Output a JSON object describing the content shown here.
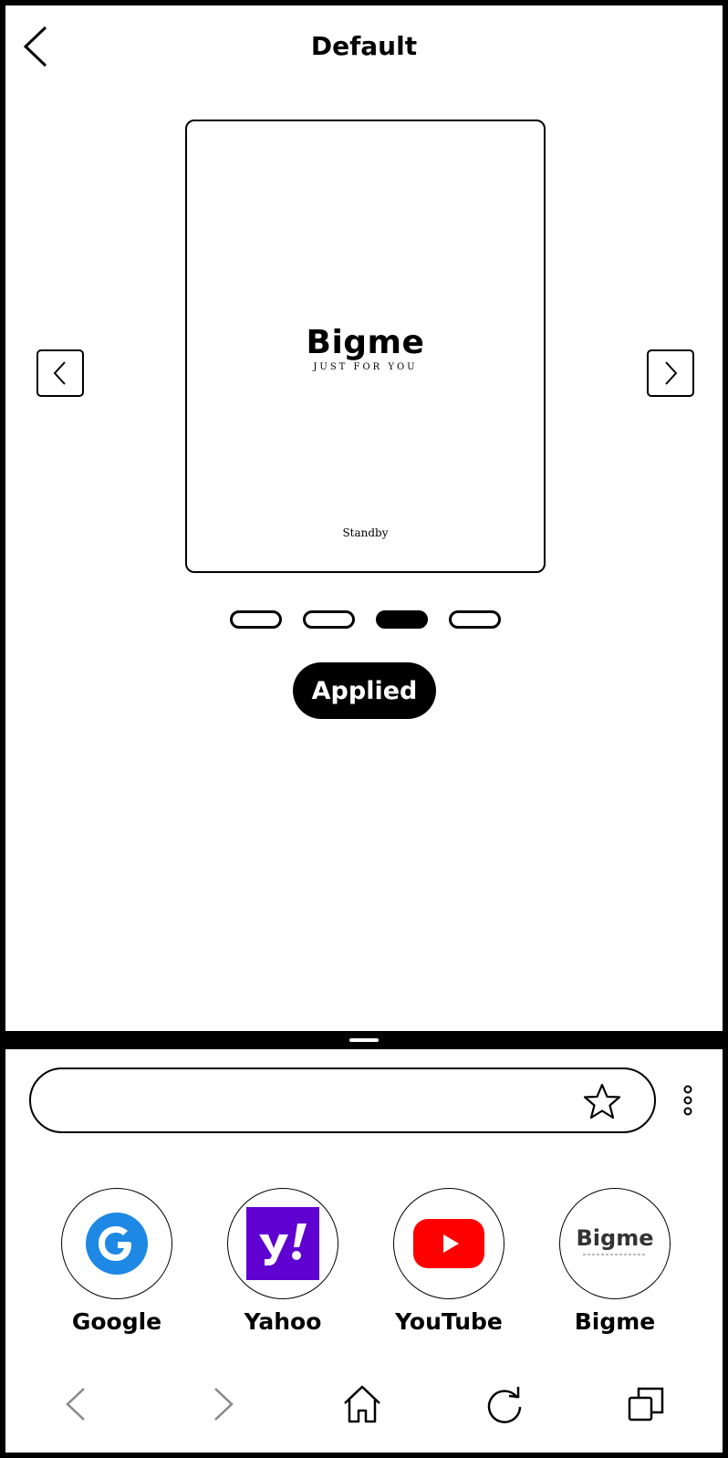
{
  "header": {
    "title": "Default"
  },
  "preview": {
    "brand": "Bigme",
    "tagline": "JUST FOR YOU",
    "status": "Standby",
    "pages_total": 4,
    "active_page": 3
  },
  "actions": {
    "applied_label": "Applied"
  },
  "browser": {
    "address_value": "",
    "shortcuts": [
      {
        "label": "Google",
        "icon": "google-icon",
        "color": "#1E88E5"
      },
      {
        "label": "Yahoo",
        "icon": "yahoo-icon",
        "color": "#5F01D1"
      },
      {
        "label": "YouTube",
        "icon": "youtube-icon",
        "color": "#FF0000"
      },
      {
        "label": "Bigme",
        "icon": "bigme-icon",
        "color": "#333333"
      }
    ],
    "bigme_logo_text": "Bigme"
  }
}
